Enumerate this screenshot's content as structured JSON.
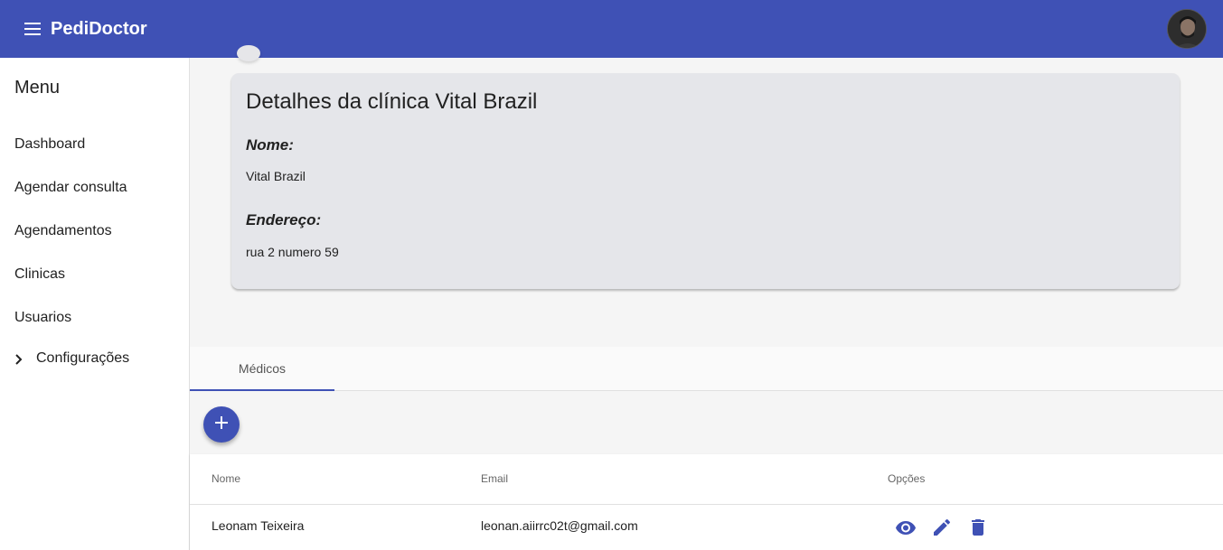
{
  "app": {
    "title": "PediDoctor"
  },
  "sidebar": {
    "heading": "Menu",
    "items": [
      {
        "label": "Dashboard"
      },
      {
        "label": "Agendar consulta"
      },
      {
        "label": "Agendamentos"
      },
      {
        "label": "Clinicas"
      },
      {
        "label": "Usuarios"
      },
      {
        "label": "Configurações"
      }
    ]
  },
  "clinic_card": {
    "title": "Detalhes da clínica Vital Brazil",
    "name_label": "Nome:",
    "name_value": "Vital Brazil",
    "address_label": "Endereço:",
    "address_value": "rua 2 numero 59"
  },
  "tabs": [
    {
      "label": "Médicos",
      "active": true
    }
  ],
  "fab_icon": "plus-icon",
  "table": {
    "columns": [
      "Nome",
      "Email",
      "Opções"
    ],
    "rows": [
      {
        "nome": "Leonam Teixeira",
        "email": "leonan.aiirrc02t@gmail.com",
        "actions": [
          "eye-icon",
          "pencil-icon",
          "trash-icon"
        ]
      }
    ]
  },
  "colors": {
    "primary": "#3f51b5",
    "card": "#e5e6ea",
    "background": "#f5f5f5"
  }
}
